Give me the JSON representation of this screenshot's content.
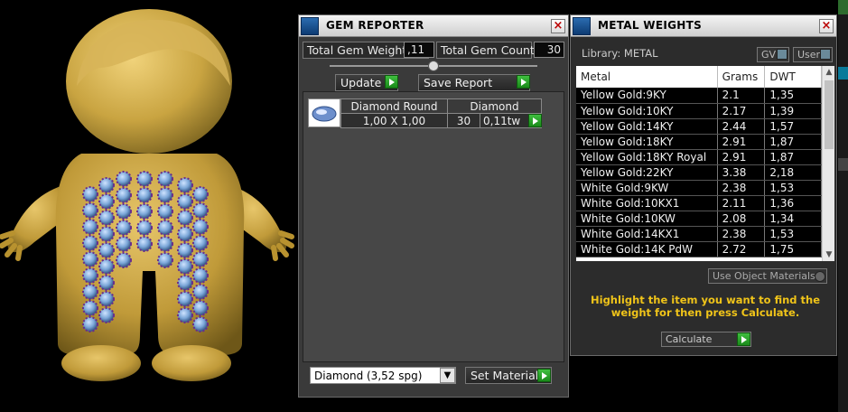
{
  "gem_reporter": {
    "title": "GEM REPORTER",
    "total_weight_label": "Total Gem Weight",
    "total_weight_value": ",11",
    "total_count_label": "Total Gem Count",
    "total_count_value": "30",
    "update_label": "Update",
    "save_report_label": "Save Report",
    "gem": {
      "shape": "Diamond Round",
      "size": "1,00 X 1,00",
      "material": "Diamond",
      "count": "30",
      "weight": "0,11tw"
    },
    "material_select": "Diamond     (3,52 spg)",
    "set_material_label": "Set Material"
  },
  "metal_weights": {
    "title": "METAL WEIGHTS",
    "library_label": "Library: METAL",
    "gv_label": "GV",
    "user_label": "User",
    "columns": [
      "Metal",
      "Grams",
      "DWT"
    ],
    "rows": [
      [
        "Yellow Gold:9KY",
        "2.1",
        "1,35"
      ],
      [
        "Yellow Gold:10KY",
        "2.17",
        "1,39"
      ],
      [
        "Yellow Gold:14KY",
        "2.44",
        "1,57"
      ],
      [
        "Yellow Gold:18KY",
        "2.91",
        "1,87"
      ],
      [
        "Yellow Gold:18KY Royal",
        "2.91",
        "1,87"
      ],
      [
        "Yellow Gold:22KY",
        "3.38",
        "2,18"
      ],
      [
        "White Gold:9KW",
        "2.38",
        "1,53"
      ],
      [
        "White Gold:10KX1",
        "2.11",
        "1,36"
      ],
      [
        "White Gold:10KW",
        "2.08",
        "1,34"
      ],
      [
        "White Gold:14KX1",
        "2.38",
        "1,53"
      ],
      [
        "White Gold:14K PdW",
        "2.72",
        "1,75"
      ]
    ],
    "use_object_label": "Use Object Materials",
    "instruction": "Highlight the item you want to find the weight for then press Calculate.",
    "calculate_label": "Calculate"
  },
  "colors": {
    "gold": "#c9a441",
    "gem_blue": "#7aa6d8",
    "gem_purple": "#6a2d8c",
    "instruction_yellow": "#f0c419"
  }
}
